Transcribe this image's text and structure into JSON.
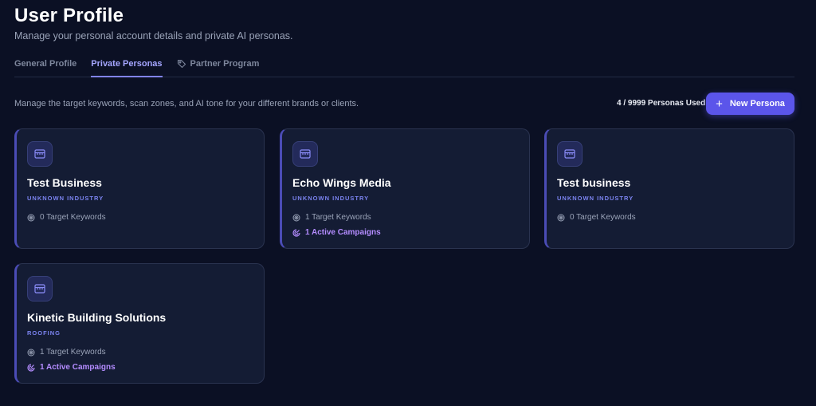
{
  "header": {
    "title": "User Profile",
    "subtitle": "Manage your personal account details and private AI personas."
  },
  "tabs": [
    {
      "label": "General Profile",
      "active": false
    },
    {
      "label": "Private Personas",
      "active": true
    },
    {
      "label": "Partner Program",
      "active": false,
      "icon": "tag-icon"
    }
  ],
  "toolbar": {
    "description": "Manage the target keywords, scan zones, and AI tone for your different brands or clients.",
    "usage": "4 / 9999 Personas Used",
    "new_button_label": "New Persona"
  },
  "personas": [
    {
      "name": "Test Business",
      "industry": "UNKNOWN INDUSTRY",
      "keywords": "0 Target Keywords",
      "campaigns": ""
    },
    {
      "name": "Echo Wings Media",
      "industry": "UNKNOWN INDUSTRY",
      "keywords": "1 Target Keywords",
      "campaigns": "1 Active Campaigns"
    },
    {
      "name": "Test business",
      "industry": "UNKNOWN INDUSTRY",
      "keywords": "0 Target Keywords",
      "campaigns": ""
    },
    {
      "name": "Kinetic Building Solutions",
      "industry": "ROOFING",
      "keywords": "1 Target Keywords",
      "campaigns": "1 Active Campaigns"
    }
  ],
  "colors": {
    "background": "#0b1024",
    "card": "#141c34",
    "accent": "#5b55ea",
    "accent_text": "#a5a6ff",
    "campaign": "#b48cff"
  }
}
